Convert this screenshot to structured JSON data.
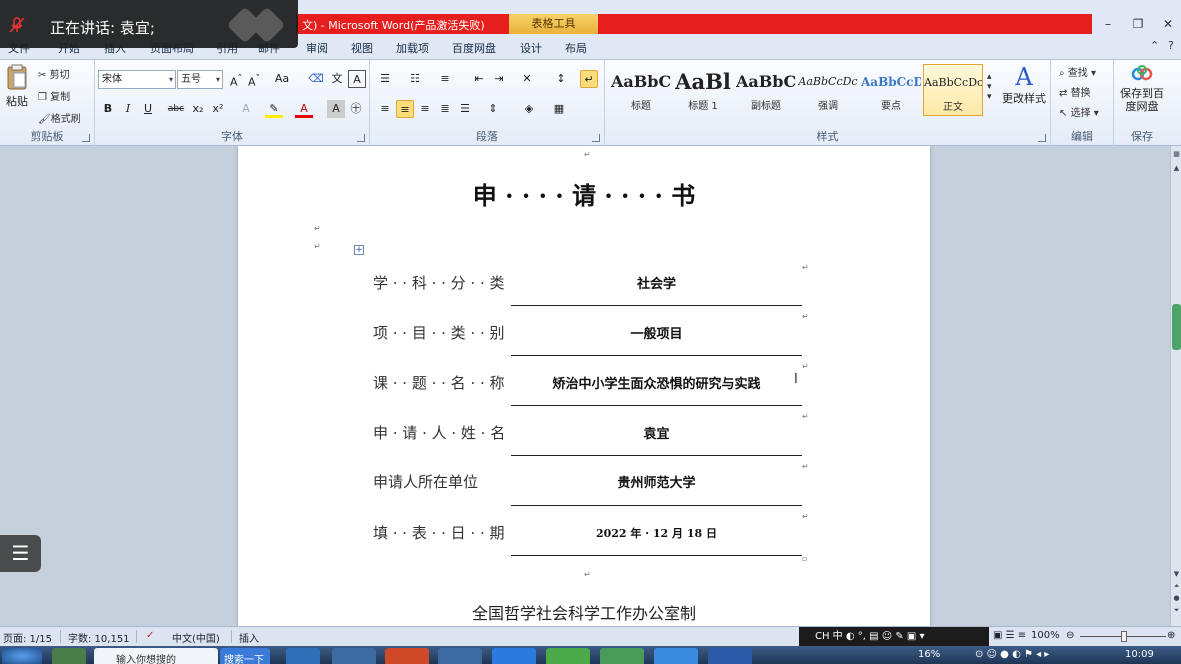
{
  "window": {
    "title_visible": "文) - Microsoft Word(产品激活失败)",
    "context_tab": "表格工具"
  },
  "speaking": {
    "label": "正在讲话: 袁宜;"
  },
  "menu_tabs": [
    "文件",
    "开始",
    "插入",
    "页面布局",
    "引用",
    "邮件",
    "审阅",
    "视图",
    "加载项",
    "百度网盘",
    "设计",
    "布局"
  ],
  "ribbon": {
    "clipboard": {
      "paste": "粘贴",
      "cut": "剪切",
      "copy": "复制",
      "format_painter": "格式刷",
      "label": "剪贴板"
    },
    "font": {
      "name": "宋体",
      "size": "五号",
      "label": "字体"
    },
    "paragraph": {
      "label": "段落"
    },
    "styles": {
      "label": "样式",
      "items": [
        {
          "sample": "AaBbC",
          "name": "标题"
        },
        {
          "sample": "AaBl",
          "name": "标题 1"
        },
        {
          "sample": "AaBbC",
          "name": "副标题"
        },
        {
          "sample": "AaBbCcDc",
          "name": "强调"
        },
        {
          "sample": "AaBbCcD",
          "name": "要点"
        },
        {
          "sample": "AaBbCcDc",
          "name": "正文"
        }
      ],
      "change_styles": "更改样式"
    },
    "editing": {
      "find": "查找",
      "replace": "替换",
      "select": "选择",
      "label": "编辑"
    },
    "save": {
      "button": "保存到百度网盘",
      "label": "保存"
    }
  },
  "document": {
    "title": "申 · · · · 请 · · · · 书",
    "rows": [
      {
        "label": "学 · · 科 · · 分 · · 类",
        "value": "社会学"
      },
      {
        "label": "项 · · 目 · · 类 · · 别",
        "value": "一般项目"
      },
      {
        "label": "课 · · 题 · · 名 · · 称",
        "value": "矫治中小学生面众恐惧的研究与实践"
      },
      {
        "label": "申 · 请 · 人 · 姓 · 名",
        "value": "袁宜"
      },
      {
        "label": "申请人所在单位",
        "value": "贵州师范大学"
      },
      {
        "label": "填 · · 表 · · 日 · · 期",
        "value": "2022 年 · 12 月 18 日"
      }
    ],
    "footer": "全国哲学社会科学工作办公室制"
  },
  "statusbar": {
    "page": "页面: 1/15",
    "words": "字数: 10,151",
    "language": "中文(中国)",
    "mode": "插入",
    "zoom": "100%",
    "ime": "CH 中"
  },
  "taskbar": {
    "browser_tab": "输入你想搜的",
    "search_button": "搜索一下",
    "cpu": "16%",
    "clock": "10:09"
  },
  "colors": {
    "title_red": "#e61e1e",
    "accent_gold": "#fbdc7a",
    "scroll_thumb": "#4fa36a"
  }
}
